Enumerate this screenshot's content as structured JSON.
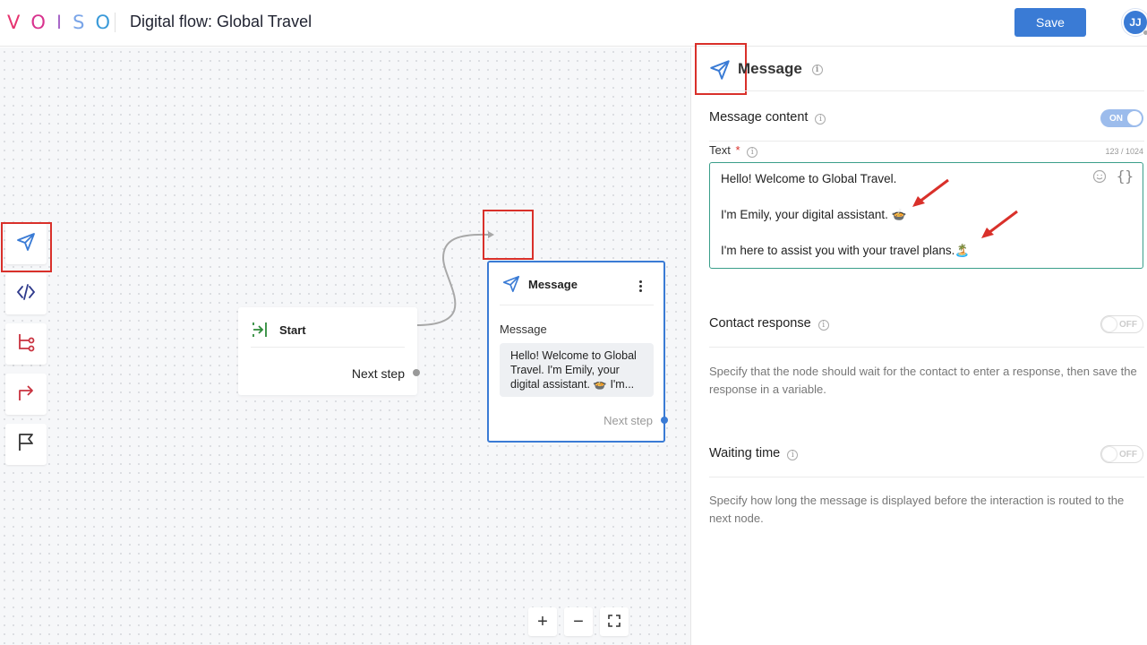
{
  "header": {
    "logo_letters": [
      "V",
      "O",
      "I",
      "S",
      "O"
    ],
    "logo_colors": [
      "#e6336f",
      "#d8328e",
      "#a868c8",
      "#7aa5e8",
      "#3a9ad9"
    ],
    "title": "Digital flow: Global Travel",
    "save_label": "Save",
    "avatar_initials": "JJ"
  },
  "toolbar": {
    "items": [
      {
        "icon": "send-icon",
        "color": "#3a7bd5"
      },
      {
        "icon": "code-icon",
        "color": "#2f3a8c"
      },
      {
        "icon": "branch-icon",
        "color": "#c9323f"
      },
      {
        "icon": "redirect-icon",
        "color": "#c9323f"
      },
      {
        "icon": "flag-icon",
        "color": "#333333"
      }
    ]
  },
  "canvas": {
    "start_node": {
      "title": "Start",
      "next_step": "Next step"
    },
    "message_node": {
      "title": "Message",
      "label": "Message",
      "preview": "Hello! Welcome to Global Travel. I'm Emily, your digital assistant. 🍲 I'm...",
      "next_step": "Next step"
    },
    "zoom": {
      "in": "+",
      "out": "−",
      "fit": "fit-screen-icon"
    }
  },
  "panel": {
    "title": "Message",
    "message_content": {
      "label": "Message content",
      "toggle": "ON"
    },
    "text_field": {
      "label": "Text",
      "required": "*",
      "char_count": "123 / 1024",
      "lines": [
        "Hello! Welcome to Global Travel.",
        "",
        "I'm Emily, your digital assistant. 🍲",
        "",
        "I'm here to assist you with your travel plans.🏝️"
      ]
    },
    "contact_response": {
      "label": "Contact response",
      "toggle": "OFF",
      "description": "Specify that the node should wait for the contact to enter a response, then save the response in a variable."
    },
    "waiting_time": {
      "label": "Waiting time",
      "toggle": "OFF",
      "description": "Specify how long the message is displayed before the interaction is routed to the next node."
    }
  },
  "colors": {
    "accent": "#3a7bd5",
    "annotation_red": "#d9302a",
    "start_green": "#2e8b3a"
  }
}
